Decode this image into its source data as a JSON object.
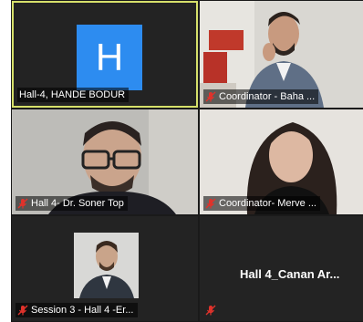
{
  "tiles": [
    {
      "name": "Hall-4, HANDE BODUR",
      "avatar_letter": "H",
      "mic": "none"
    },
    {
      "name": "Coordinator - Baha ...",
      "mic": "muted"
    },
    {
      "name": "Hall 4- Dr. Soner Top",
      "mic": "muted"
    },
    {
      "name": "Coordinator- Merve ...",
      "mic": "muted"
    },
    {
      "name": "Session 3 - Hall 4 -Er...",
      "mic": "muted"
    },
    {
      "name": "Hall 4_Canan Ar...",
      "mic": "muted"
    }
  ],
  "colors": {
    "active_border": "#d6e06a",
    "avatar_bg": "#2d8cf0",
    "muted_mic": "#e0322b"
  }
}
